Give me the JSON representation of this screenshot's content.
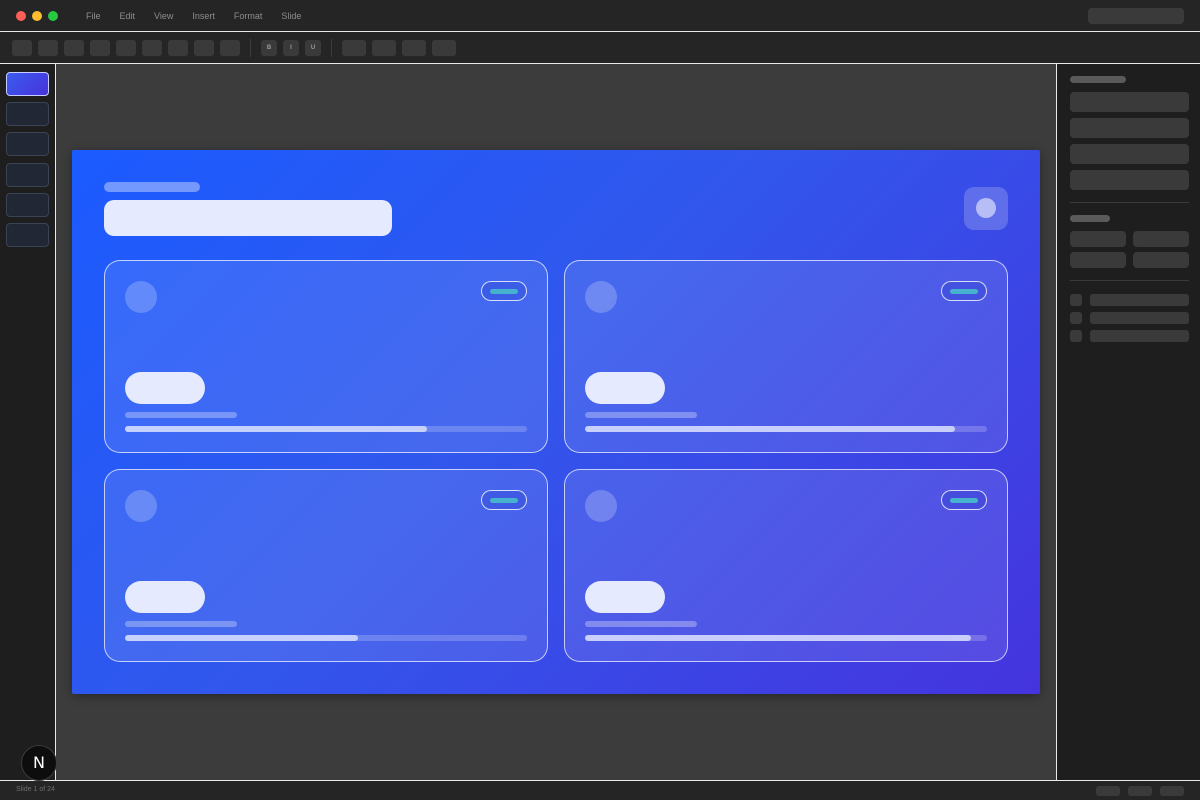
{
  "menu": [
    "File",
    "Edit",
    "View",
    "Insert",
    "Format",
    "Slide"
  ],
  "toolbar": {
    "format_buttons": [
      "B",
      "I",
      "U"
    ]
  },
  "status": {
    "slide_counter": "Slide 1 of 24"
  },
  "badge": {
    "letter": "N"
  },
  "colors": {
    "accent_start": "#1b5bff",
    "accent_end": "#4534de",
    "badge_teal": "#47b2cf"
  },
  "slide": {
    "cards": [
      {
        "progress": 0.75
      },
      {
        "progress": 0.92
      },
      {
        "progress": 0.58
      },
      {
        "progress": 0.96
      }
    ]
  }
}
